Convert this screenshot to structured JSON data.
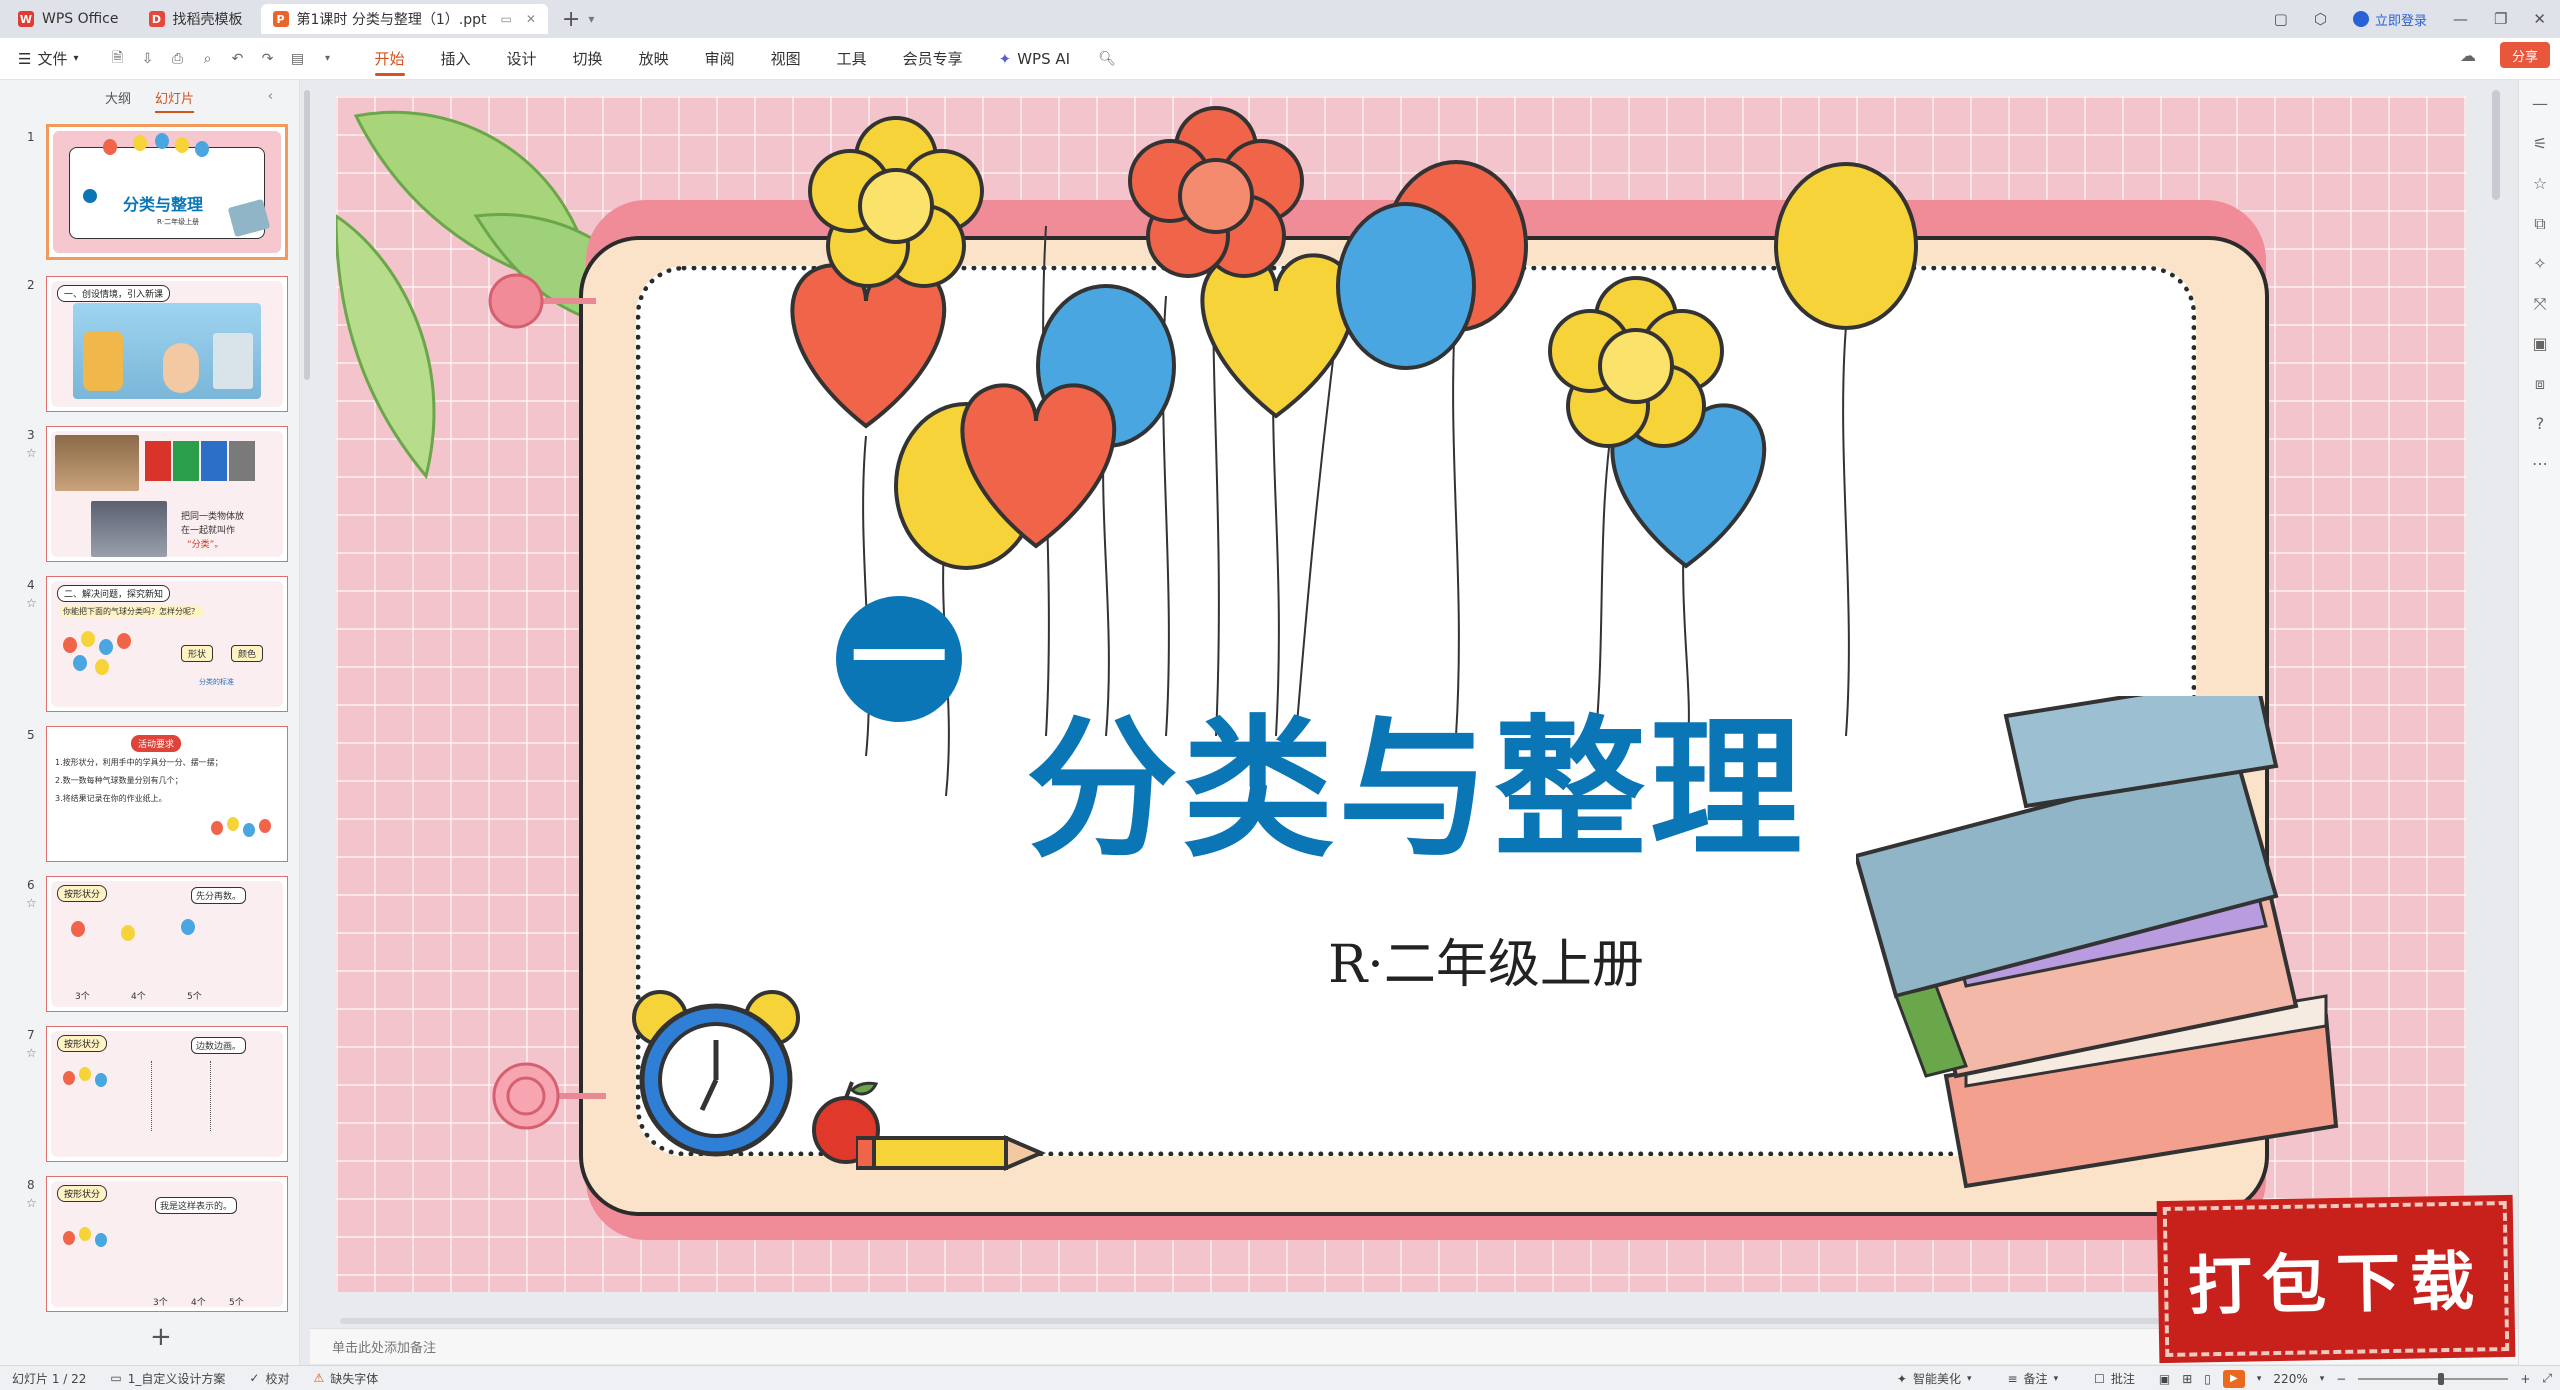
{
  "tabs": [
    {
      "label": "WPS Office",
      "color": "#e03c31",
      "glyph": "W"
    },
    {
      "label": "找稻壳模板",
      "color": "#e6473b",
      "glyph": "D"
    },
    {
      "label": "第1课时 分类与整理（1）.ppt",
      "color": "#e8652b",
      "glyph": "P"
    }
  ],
  "window": {
    "login_label": "立即登录"
  },
  "menu": {
    "file_label": "文件",
    "items": [
      "开始",
      "插入",
      "设计",
      "切换",
      "放映",
      "审阅",
      "视图",
      "工具",
      "会员专享",
      "WPS AI"
    ],
    "active": "开始",
    "share_label": "分享"
  },
  "panel": {
    "tab_outline": "大纲",
    "tab_slides": "幻灯片"
  },
  "thumbnails": [
    {
      "num": "1",
      "title": "分类与整理",
      "sub": "R·二年级上册"
    },
    {
      "num": "2",
      "header": "一、创设情境，引入新课"
    },
    {
      "num": "3",
      "text": [
        "把同一类物体放",
        "在一起就叫作",
        "“分类”。"
      ]
    },
    {
      "num": "4",
      "header": "二、解决问题，探究新知",
      "question": "你能把下面的气球分类吗？怎样分呢？",
      "tags": [
        "形状",
        "颜色"
      ],
      "caption": "分类的标准"
    },
    {
      "num": "5",
      "header": "活动要求",
      "lines": [
        "1.按形状分，利用手中的学具分一分、摆一摆；",
        "2.数一数每种气球数量分别有几个；",
        "3.将结果记录在你的作业纸上。"
      ]
    },
    {
      "num": "6",
      "header": "按形状分",
      "bubble": "先分再数。",
      "counts": [
        "3个",
        "4个",
        "5个"
      ]
    },
    {
      "num": "7",
      "header": "按形状分",
      "bubble": "边数边画。"
    },
    {
      "num": "8",
      "header": "按形状分",
      "bubble": "我是这样表示的。",
      "counts": [
        "3个",
        "4个",
        "5个"
      ]
    }
  ],
  "slide": {
    "badge": "一",
    "title": "分类与整理",
    "subtitle": "R·二年级上册",
    "title_color": "#0a76b6"
  },
  "stamp": {
    "label": "打包下载"
  },
  "notes": {
    "placeholder": "单击此处添加备注"
  },
  "status": {
    "slide_counter": "幻灯片 1 / 22",
    "theme": "1_自定义设计方案",
    "proof": "校对",
    "missing_font": "缺失字体",
    "beautify": "智能美化",
    "notes_btn": "备注",
    "comments": "批注",
    "zoom": "220%",
    "zoom_value": 0.55
  },
  "colors": {
    "accent": "#d4531e",
    "share": "#e8573b",
    "stamp": "#c8201b"
  }
}
